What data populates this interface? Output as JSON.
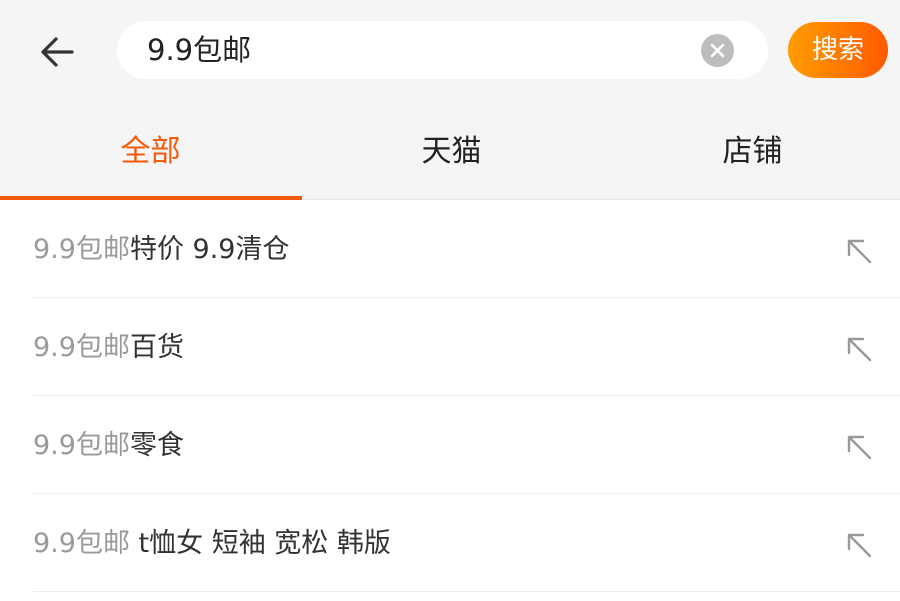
{
  "header": {
    "back_icon": "arrow-left-icon",
    "search_value": "9.9包邮",
    "clear_icon": "clear-circle-x-icon",
    "search_button_label": "搜索"
  },
  "tabs": [
    {
      "label": "全部",
      "active": true
    },
    {
      "label": "天猫",
      "active": false
    },
    {
      "label": "店铺",
      "active": false
    }
  ],
  "suggestions": [
    {
      "prefix": "9.9包邮",
      "suffix": "特价 9.9清仓"
    },
    {
      "prefix": "9.9包邮",
      "suffix": "百货"
    },
    {
      "prefix": "9.9包邮",
      "suffix": "零食"
    },
    {
      "prefix": "9.9包邮",
      "suffix": " t恤女 短袖 宽松 韩版"
    }
  ],
  "suggestion_fill_icon": "arrow-up-left-icon",
  "colors": {
    "accent": "#f55a0a",
    "search_button_gradient_start": "#ff9d00",
    "search_button_gradient_end": "#ff5a00",
    "header_background": "#f5f5f5",
    "prefix_text": "#9a9a9a"
  }
}
